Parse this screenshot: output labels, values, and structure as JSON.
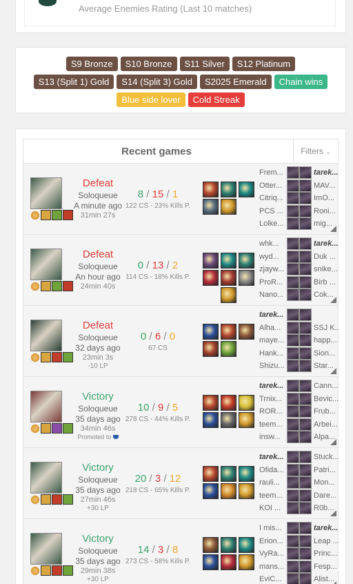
{
  "top_card": {
    "label": "Average Enemies Rating (Last 10 matches)"
  },
  "tags": [
    {
      "label": "S9 Bronze",
      "color": "brown"
    },
    {
      "label": "S10 Bronze",
      "color": "brown"
    },
    {
      "label": "S11 Silver",
      "color": "brown"
    },
    {
      "label": "S12 Platinum",
      "color": "brown"
    },
    {
      "label": "S13 (Split 1) Gold",
      "color": "brown"
    },
    {
      "label": "S14 (Split 3) Gold",
      "color": "brown"
    },
    {
      "label": "S2025 Emerald",
      "color": "brown"
    },
    {
      "label": "Chain wins",
      "color": "green"
    },
    {
      "label": "Blue side lover",
      "color": "yellow"
    },
    {
      "label": "Cold Streak",
      "color": "red"
    }
  ],
  "games_section": {
    "title": "Recent games",
    "filters_label": "Filters",
    "filters_icon": "chevron-down-icon"
  },
  "games": [
    {
      "status": "Defeat",
      "queue": "Soloqueue",
      "ago": "A minute ago",
      "duration": "31min 27s",
      "lp": "",
      "promo": "",
      "k": "8",
      "d": "15",
      "a": "1",
      "cs": "122",
      "kp": "23% Kills P.",
      "champ_color": "#3c5a4a",
      "spells": [
        "#d8a640",
        "#6ea43a",
        "#c23d29"
      ],
      "items": [
        "#b5462f",
        "#2e7f73",
        "#1d8a86",
        "#5a6e82",
        "#d39b2c",
        "",
        ""
      ],
      "team_left": [
        "Frem...",
        "Otter...",
        "Citriq...",
        "PCS ...",
        "Lolke..."
      ],
      "team_right": [
        "tarek...",
        "MAV...",
        "ImO...",
        "Roni...",
        "mig..."
      ],
      "me_right": 0
    },
    {
      "status": "Defeat",
      "queue": "Soloqueue",
      "ago": "An hour ago",
      "duration": "24min 40s",
      "lp": "",
      "promo": "",
      "k": "0",
      "d": "13",
      "a": "2",
      "cs": "114",
      "kp": "18% Kills P.",
      "champ_color": "#3c5a4a",
      "spells": [
        "#d8a640",
        "#6ea43a",
        "#c23d29"
      ],
      "items": [
        "#6b4a7a",
        "#1d8a86",
        "#2e7f73",
        "#b52c3a",
        "#a33b32",
        "#8a8a8a",
        "#d39b2c"
      ],
      "team_left": [
        "whk...",
        "wyd...",
        "zjayw...",
        "ProR...",
        "Nano..."
      ],
      "team_right": [
        "tarek...",
        "Duk ...",
        "snike...",
        "Birb ...",
        "Cok..."
      ],
      "me_right": 0
    },
    {
      "status": "Defeat",
      "queue": "Soloqueue",
      "ago": "32 days ago",
      "duration": "23min 3s",
      "lp": "-10 LP",
      "promo": "",
      "k": "0",
      "d": "6",
      "a": "0",
      "cs": "67",
      "kp": "",
      "champ_color": "#2a3e34",
      "spells": [
        "#d8a640",
        "#c23d29",
        "#6ea43a"
      ],
      "items": [
        "#2a4f9a",
        "#b5462f",
        "#8c5a3a",
        "#a3412d",
        "#6ea43a",
        "",
        ""
      ],
      "team_left": [
        "tarek...",
        "Alha...",
        "maye...",
        "Hank...",
        "Shizu..."
      ],
      "team_right": [
        "",
        "SSJ K...",
        "happ...",
        "Sion...",
        "Star..."
      ],
      "me_left": 0
    },
    {
      "status": "Victory",
      "queue": "Soloqueue",
      "ago": "35 days ago",
      "duration": "34min 46s",
      "lp": "",
      "promo": "Promoted to",
      "k": "10",
      "d": "9",
      "a": "5",
      "cs": "278",
      "kp": "44% Kills P.",
      "champ_color": "#7a3b3b",
      "spells": [
        "#d8a640",
        "#8b4ea8",
        "#6ea43a"
      ],
      "items": [
        "#b5462f",
        "#c23d29",
        "#d9c13a",
        "#2a4f9a",
        "#6a6a6a",
        "#d39b2c",
        ""
      ],
      "team_left": [
        "tarek...",
        "Trnix...",
        "ROR...",
        "teem...",
        "insw..."
      ],
      "team_right": [
        "Cann...",
        "Bevic...",
        "Frub...",
        "Arbei...",
        "Alpa..."
      ],
      "me_left": 0
    },
    {
      "status": "Victory",
      "queue": "Soloqueue",
      "ago": "35 days ago",
      "duration": "27min 46s",
      "lp": "+30 LP",
      "promo": "",
      "k": "20",
      "d": "3",
      "a": "12",
      "cs": "218",
      "kp": "65% Kills P.",
      "champ_color": "#3c5a4a",
      "spells": [
        "#d8a640",
        "#c23d29",
        "#6ea43a"
      ],
      "items": [
        "#b5462f",
        "#2e7f73",
        "#1d8a86",
        "#2a4f9a",
        "#d38a2c",
        "#d39b2c",
        ""
      ],
      "team_left": [
        "tarek...",
        "Ofida...",
        "rauli...",
        "teem...",
        "KOI ..."
      ],
      "team_right": [
        "Stuck...",
        "Patri...",
        "Mon...",
        "Dare...",
        "R0b..."
      ],
      "me_left": 0
    },
    {
      "status": "Victory",
      "queue": "Soloqueue",
      "ago": "35 days ago",
      "duration": "29min 38s",
      "lp": "+30 LP",
      "promo": "",
      "k": "14",
      "d": "3",
      "a": "8",
      "cs": "273",
      "kp": "58% Kills P.",
      "champ_color": "#3c5a4a",
      "spells": [
        "#d8a640",
        "#c23d29",
        "#6ea43a"
      ],
      "items": [
        "#8c5a3a",
        "#2e7f73",
        "#1d8a86",
        "#2a4f9a",
        "#b52c3a",
        "#d39b2c",
        ""
      ],
      "team_left": [
        "I mis...",
        "Erion...",
        "VyRa...",
        "mans...",
        "EviC..."
      ],
      "team_right": [
        "tarek...",
        "Leap ...",
        "Princ...",
        "Fesp...",
        "Alist..."
      ],
      "me_right": 0
    }
  ]
}
